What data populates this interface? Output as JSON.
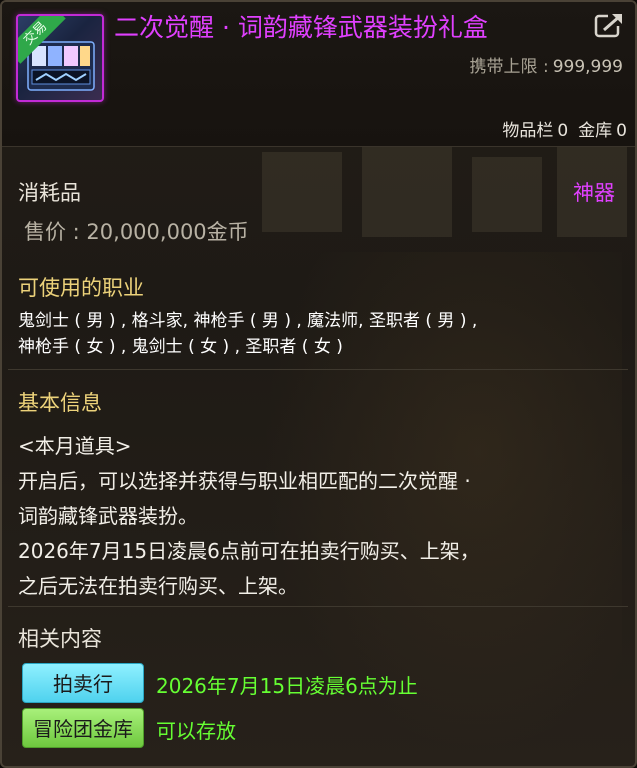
{
  "item": {
    "title": "二次觉醒 · 词韵藏锋武器装扮礼盒",
    "trade_badge": "交易",
    "carry_limit_label": "携带上限 :",
    "carry_limit_value": "999,999",
    "storage": {
      "inventory_label": "物品栏",
      "inventory_count": "0",
      "bank_label": "金库",
      "bank_count": "0"
    },
    "type": "消耗品",
    "grade": "神器",
    "price": "售价 : 20,000,000金币"
  },
  "jobs": {
    "title": "可使用的职业",
    "lines": [
      "鬼剑士 ( 男 ) , 格斗家, 神枪手 ( 男 ) , 魔法师, 圣职者 ( 男 ) ,",
      "神枪手 ( 女 ) , 鬼剑士 ( 女 ) , 圣职者 ( 女 )"
    ]
  },
  "basic_info": {
    "title": "基本信息",
    "lines": [
      "<本月道具>",
      "开启后，可以选择并获得与职业相匹配的二次觉醒 ·",
      "词韵藏锋武器装扮。",
      "2026年7月15日凌晨6点前可在拍卖行购买、上架，",
      "之后无法在拍卖行购买、上架。"
    ]
  },
  "related": {
    "title": "相关内容",
    "auction_button": "拍卖行",
    "auction_value": "2026年7月15日凌晨6点为止",
    "bank_button": "冒险团金库",
    "bank_value": "可以存放"
  },
  "icons": {
    "share": "share-export-icon",
    "item": "gift-box-item-icon"
  },
  "colors": {
    "title_purple": "#e040ff",
    "section_gold": "#ecd27a",
    "value_green": "#66ff33",
    "auction_button": "#5fdcf2",
    "bank_button": "#86d857"
  }
}
